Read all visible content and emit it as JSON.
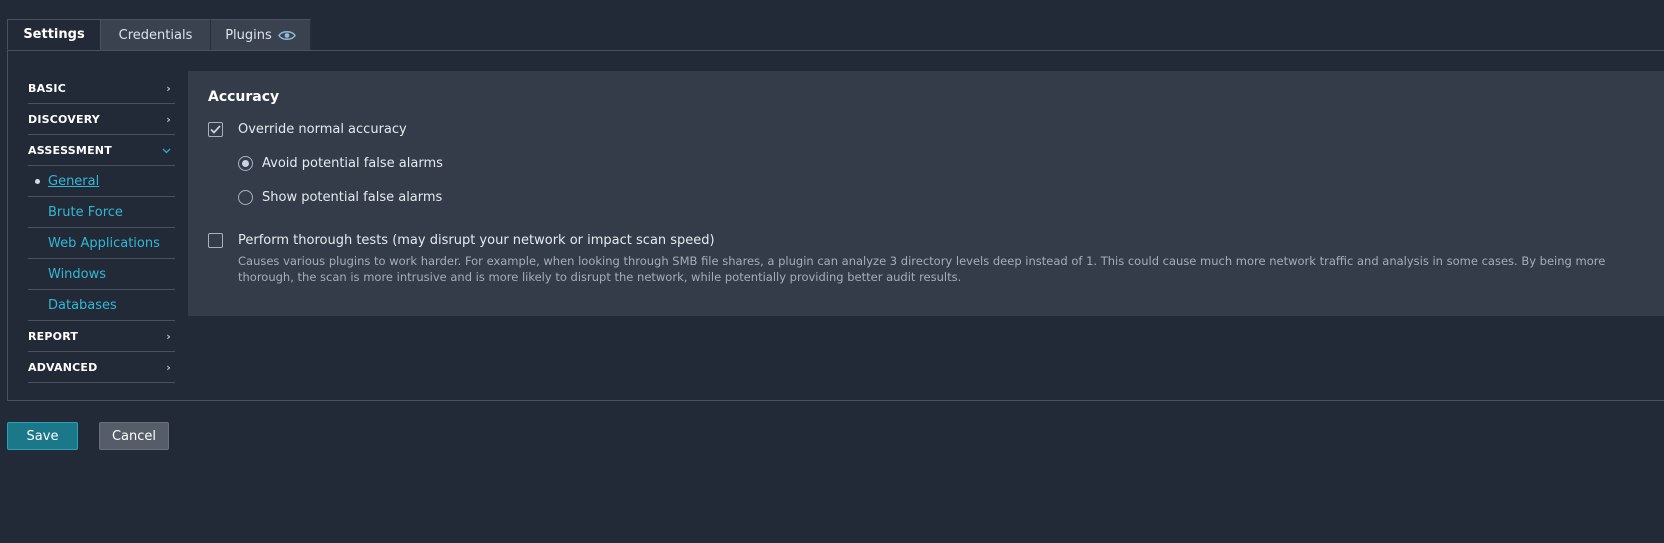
{
  "tabs": [
    {
      "label": "Settings",
      "active": true
    },
    {
      "label": "Credentials",
      "active": false
    },
    {
      "label": "Plugins",
      "active": false,
      "icon": "eye-icon"
    }
  ],
  "nav": {
    "basic": "BASIC",
    "discovery": "DISCOVERY",
    "assessment": "ASSESSMENT",
    "assessment_items": [
      "General",
      "Brute Force",
      "Web Applications",
      "Windows",
      "Databases"
    ],
    "report": "REPORT",
    "advanced": "ADVANCED"
  },
  "content": {
    "heading": "Accuracy",
    "override_label": "Override normal accuracy",
    "override_checked": true,
    "radio_avoid": "Avoid potential false alarms",
    "radio_show": "Show potential false alarms",
    "radio_selected": "avoid",
    "thorough_label": "Perform thorough tests (may disrupt your network or impact scan speed)",
    "thorough_checked": false,
    "thorough_desc": "Causes various plugins to work harder. For example, when looking through SMB file shares, a plugin can analyze 3 directory levels deep instead of 1. This could cause much more network traffic and analysis in some cases. By being more thorough, the scan is more intrusive and is more likely to disrupt the network, while potentially providing better audit results."
  },
  "buttons": {
    "save": "Save",
    "cancel": "Cancel"
  },
  "colors": {
    "accent": "#33b7d4",
    "save_bg": "#1a7889",
    "background": "#222a38",
    "panel": "#343c4a"
  }
}
